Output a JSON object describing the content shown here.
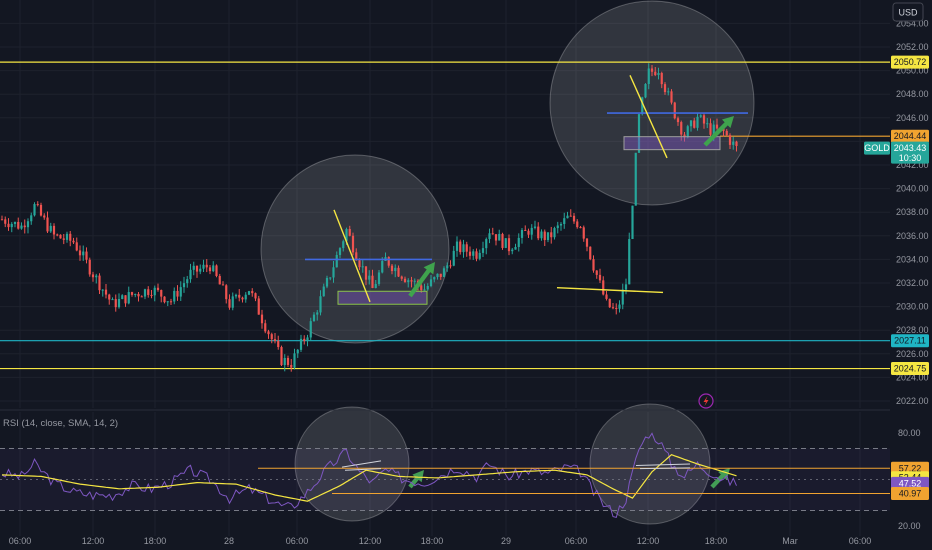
{
  "currency_button": "USD",
  "colors": {
    "bg": "#131722",
    "up": "#26a69a",
    "down": "#ef5350",
    "yellow": "#f5e642",
    "orange": "#f0a330",
    "cyan": "#1fb5c4",
    "blue": "#4169e1",
    "purple": "#7e57c2",
    "green_arrow": "#3fa34d"
  },
  "chart_data": [
    {
      "type": "candlestick",
      "symbol": "GOLD",
      "last_price": "2043.43",
      "countdown": "10:30",
      "x_tick_labels": [
        "06:00",
        "12:00",
        "18:00",
        "28",
        "06:00",
        "12:00",
        "18:00",
        "29",
        "06:00",
        "12:00",
        "18:00",
        "Mar",
        "06:00"
      ],
      "y_tick_labels": [
        "2054.00",
        "2052.00",
        "2050.00",
        "2048.00",
        "2046.00",
        "2044.00",
        "2042.00",
        "2040.00",
        "2038.00",
        "2036.00",
        "2034.00",
        "2032.00",
        "2030.00",
        "2028.00",
        "2026.00",
        "2024.00",
        "2022.00"
      ],
      "ylim": [
        2021.5,
        2055.5
      ],
      "horizontal_levels": [
        {
          "label": "2050.72",
          "value": 2050.72,
          "color": "yellow"
        },
        {
          "label": "2044.44",
          "value": 2044.44,
          "color": "orange"
        },
        {
          "label": "2027.11",
          "value": 2027.11,
          "color": "cyan"
        },
        {
          "label": "2024.75",
          "value": 2024.75,
          "color": "yellow"
        }
      ],
      "price_anchors": [
        [
          0,
          2037.4
        ],
        [
          6,
          2036.8
        ],
        [
          10,
          2038.5
        ],
        [
          16,
          2036.0
        ],
        [
          22,
          2035.5
        ],
        [
          28,
          2032.8
        ],
        [
          34,
          2030.2
        ],
        [
          40,
          2031.0
        ],
        [
          46,
          2031.5
        ],
        [
          52,
          2030.5
        ],
        [
          58,
          2032.8
        ],
        [
          64,
          2033.5
        ],
        [
          70,
          2030.2
        ],
        [
          76,
          2031.5
        ],
        [
          80,
          2029.0
        ],
        [
          86,
          2025.5
        ],
        [
          89,
          2025.2
        ],
        [
          94,
          2027.8
        ],
        [
          100,
          2032.0
        ],
        [
          106,
          2036.5
        ],
        [
          110,
          2033.8
        ],
        [
          114,
          2031.5
        ],
        [
          118,
          2034.0
        ],
        [
          124,
          2032.5
        ],
        [
          130,
          2031.5
        ],
        [
          136,
          2033.0
        ],
        [
          140,
          2035.0
        ],
        [
          146,
          2034.5
        ],
        [
          150,
          2036.5
        ],
        [
          156,
          2035.0
        ],
        [
          162,
          2036.5
        ],
        [
          168,
          2035.8
        ],
        [
          174,
          2037.5
        ],
        [
          178,
          2037.0
        ],
        [
          182,
          2033.5
        ],
        [
          186,
          2030.2
        ],
        [
          189,
          2029.5
        ],
        [
          192,
          2032.0
        ],
        [
          196,
          2046.0
        ],
        [
          199,
          2049.8
        ],
        [
          202,
          2050.2
        ],
        [
          206,
          2047.0
        ],
        [
          210,
          2044.5
        ],
        [
          214,
          2046.0
        ],
        [
          218,
          2045.0
        ],
        [
          222,
          2044.8
        ],
        [
          226,
          2043.4
        ]
      ],
      "annotations": {
        "support_zones": [
          [
            2030.2,
            2031.3
          ],
          [
            2043.3,
            2044.4
          ]
        ],
        "resistance_lines": [
          2034.0,
          2046.4
        ],
        "trend_lines": [
          [
            2038.2,
            2030.4
          ],
          [
            2049.6,
            2042.6
          ]
        ],
        "breakout_line": [
          2031.6,
          2031.2
        ]
      }
    },
    {
      "type": "line",
      "title": "RSI (14, close, SMA, 14, 2)",
      "y_tick_labels": [
        "80.00",
        "20.00"
      ],
      "ylim": [
        14,
        88
      ],
      "value_tags": [
        {
          "label": "57.22",
          "value": 57.22,
          "color": "orange"
        },
        {
          "label": "52.44",
          "value": 52.44,
          "color": "yellow"
        },
        {
          "label": "47.52",
          "value": 47.52,
          "color": "purple"
        },
        {
          "label": "40.97",
          "value": 40.97,
          "color": "orange"
        }
      ],
      "bands": [
        70,
        30
      ],
      "rsi_anchors": [
        [
          0,
          54
        ],
        [
          6,
          52
        ],
        [
          10,
          60
        ],
        [
          16,
          48
        ],
        [
          22,
          42
        ],
        [
          28,
          40
        ],
        [
          34,
          40
        ],
        [
          40,
          46
        ],
        [
          46,
          44
        ],
        [
          52,
          48
        ],
        [
          58,
          56
        ],
        [
          64,
          50
        ],
        [
          70,
          38
        ],
        [
          76,
          44
        ],
        [
          80,
          40
        ],
        [
          86,
          33
        ],
        [
          89,
          32
        ],
        [
          94,
          42
        ],
        [
          100,
          57
        ],
        [
          106,
          68
        ],
        [
          110,
          55
        ],
        [
          114,
          48
        ],
        [
          118,
          56
        ],
        [
          124,
          50
        ],
        [
          130,
          48
        ],
        [
          136,
          54
        ],
        [
          140,
          58
        ],
        [
          146,
          52
        ],
        [
          150,
          60
        ],
        [
          156,
          52
        ],
        [
          162,
          56
        ],
        [
          168,
          54
        ],
        [
          174,
          58
        ],
        [
          178,
          55
        ],
        [
          182,
          42
        ],
        [
          186,
          32
        ],
        [
          189,
          28
        ],
        [
          192,
          38
        ],
        [
          196,
          70
        ],
        [
          199,
          80
        ],
        [
          202,
          76
        ],
        [
          206,
          60
        ],
        [
          210,
          52
        ],
        [
          214,
          60
        ],
        [
          218,
          55
        ],
        [
          222,
          50
        ],
        [
          226,
          47.5
        ]
      ],
      "sma_anchors": [
        [
          0,
          53
        ],
        [
          12,
          52
        ],
        [
          24,
          47
        ],
        [
          36,
          44
        ],
        [
          48,
          45
        ],
        [
          60,
          48
        ],
        [
          72,
          47
        ],
        [
          84,
          40
        ],
        [
          94,
          36
        ],
        [
          104,
          46
        ],
        [
          112,
          56
        ],
        [
          122,
          52
        ],
        [
          134,
          51
        ],
        [
          146,
          53
        ],
        [
          158,
          55
        ],
        [
          170,
          56
        ],
        [
          180,
          53
        ],
        [
          188,
          44
        ],
        [
          194,
          38
        ],
        [
          200,
          55
        ],
        [
          206,
          66
        ],
        [
          214,
          60
        ],
        [
          222,
          55
        ],
        [
          226,
          52.4
        ]
      ]
    }
  ]
}
